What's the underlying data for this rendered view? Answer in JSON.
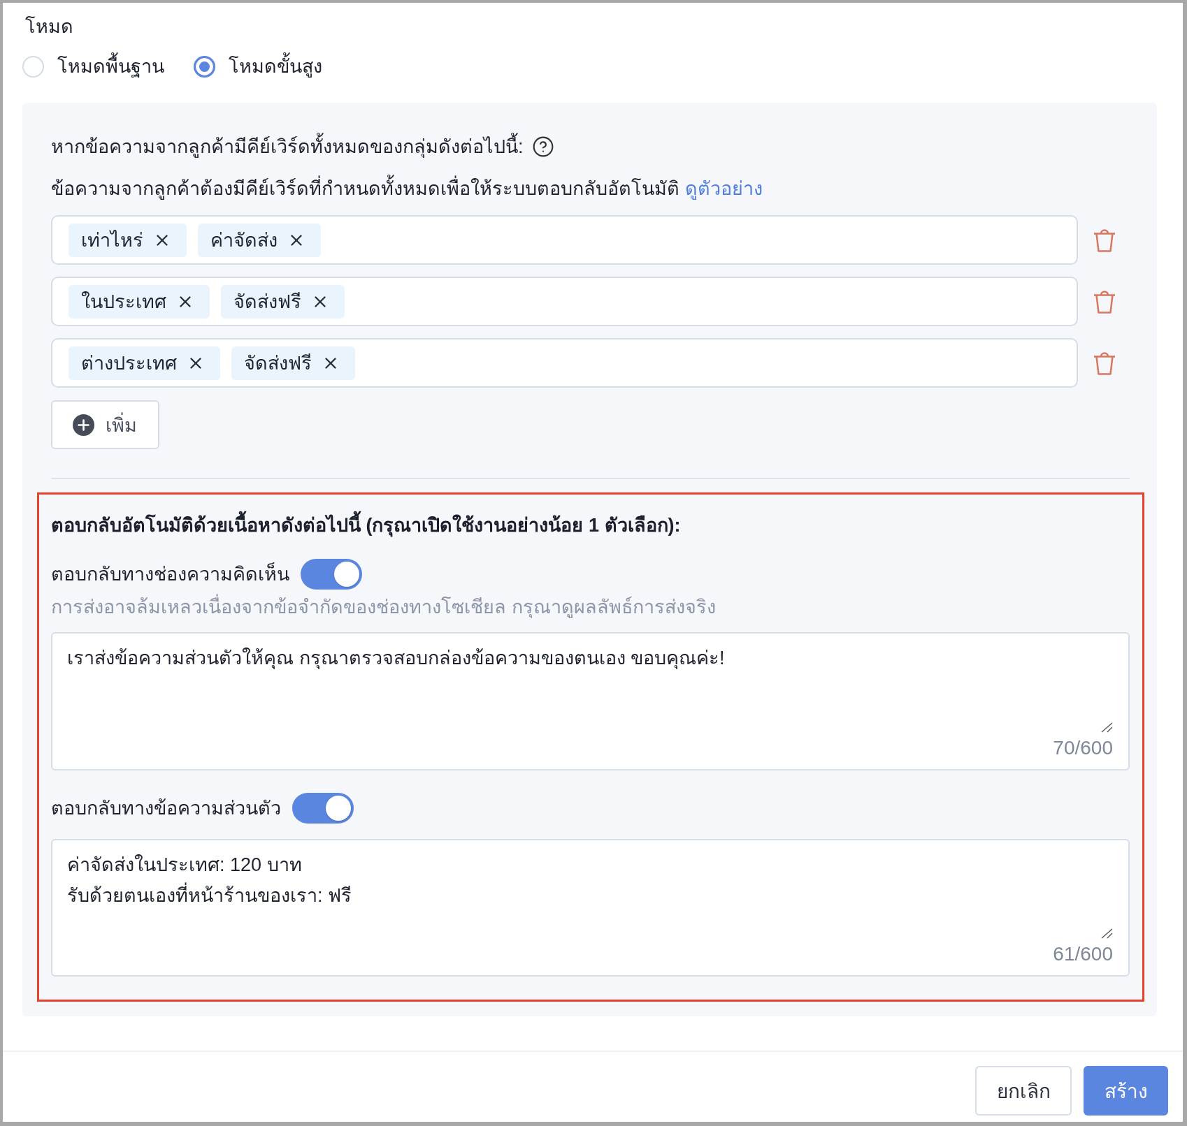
{
  "mode": {
    "label": "โหมด",
    "options": [
      {
        "label": "โหมดพื้นฐาน",
        "selected": false
      },
      {
        "label": "โหมดขั้นสูง",
        "selected": true
      }
    ]
  },
  "keyword_rule": {
    "heading": "หากข้อความจากลูกค้ามีคีย์เวิร์ดทั้งหมดของกลุ่มดังต่อไปนี้:",
    "description": "ข้อความจากลูกค้าต้องมีคีย์เวิร์ดที่กำหนดทั้งหมดเพื่อให้ระบบตอบกลับอัตโนมัติ",
    "example_link": "ดูตัวอย่าง",
    "groups": [
      {
        "keywords": [
          "เท่าไหร่",
          "ค่าจัดส่ง"
        ]
      },
      {
        "keywords": [
          "ในประเทศ",
          "จัดส่งฟรี"
        ]
      },
      {
        "keywords": [
          "ต่างประเทศ",
          "จัดส่งฟรี"
        ]
      }
    ],
    "add_button": "เพิ่ม"
  },
  "auto_reply": {
    "heading": "ตอบกลับอัตโนมัติด้วยเนื้อหาดังต่อไปนี้ (กรุณาเปิดใช้งานอย่างน้อย 1 ตัวเลือก):",
    "channels": [
      {
        "label": "ตอบกลับทางช่องความคิดเห็น",
        "on": true,
        "hint": "การส่งอาจล้มเหลวเนื่องจากข้อจำกัดของช่องทางโซเชียล กรุณาดูผลลัพธ์การส่งจริง",
        "message": "เราส่งข้อความส่วนตัวให้คุณ กรุณาตรวจสอบกล่องข้อความของตนเอง ขอบคุณค่ะ!",
        "counter": "70/600"
      },
      {
        "label": "ตอบกลับทางข้อความส่วนตัว",
        "on": true,
        "message": "ค่าจัดส่งในประเทศ: 120 บาท\nรับด้วยตนเองที่หน้าร้านของเรา: ฟรี",
        "counter": "61/600"
      }
    ]
  },
  "footer": {
    "buttons": [
      {
        "label": "ยกเลิก",
        "kind": "secondary"
      },
      {
        "label": "สร้าง",
        "kind": "primary"
      }
    ]
  }
}
